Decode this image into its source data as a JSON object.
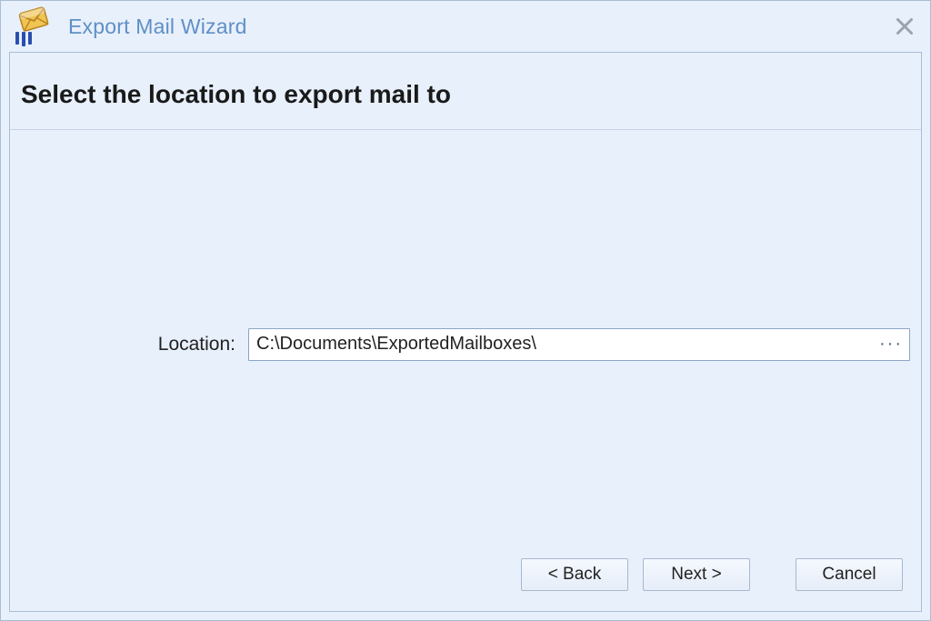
{
  "window": {
    "title": "Export Mail Wizard",
    "icon_name": "mail-envelope-icon"
  },
  "page": {
    "heading": "Select the location to export mail to"
  },
  "form": {
    "location_label": "Location:",
    "location_value": "C:\\Documents\\ExportedMailboxes\\",
    "browse_glyph": "···"
  },
  "buttons": {
    "back": "< Back",
    "next": "Next >",
    "cancel": "Cancel"
  }
}
